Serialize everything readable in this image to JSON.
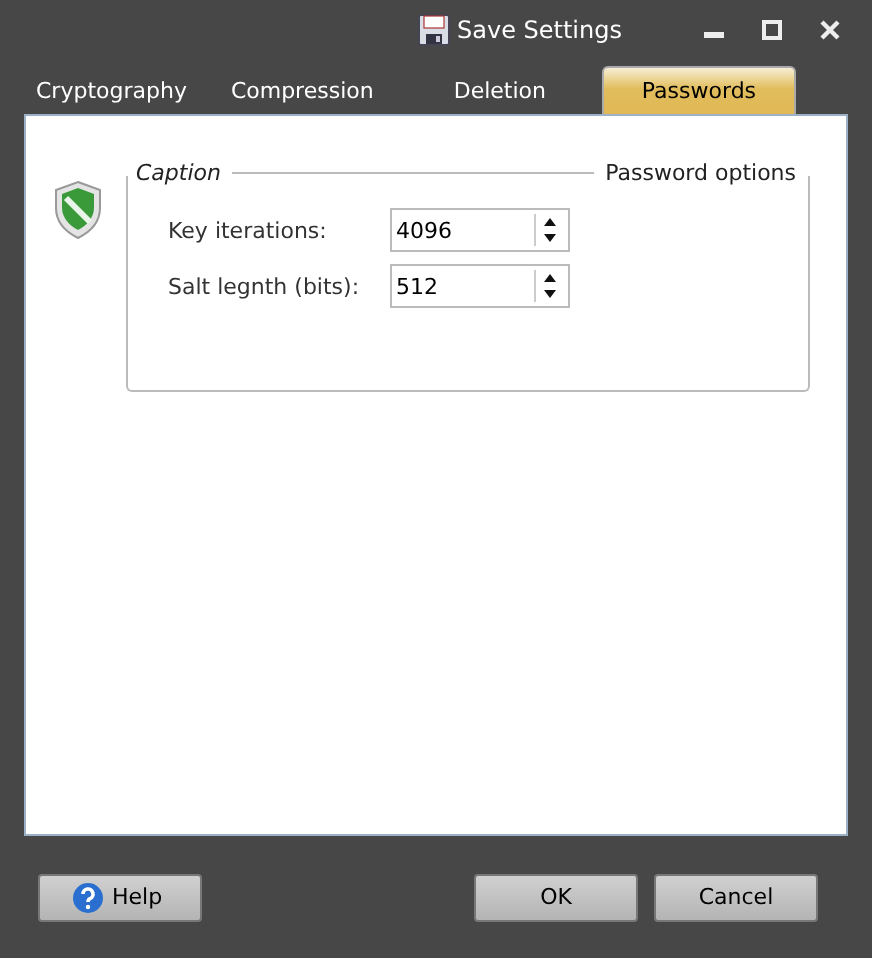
{
  "toolbar": {
    "save_label": "Save Settings"
  },
  "tabs": [
    {
      "label": "Cryptography",
      "selected": false
    },
    {
      "label": "Compression",
      "selected": false
    },
    {
      "label": "Deletion",
      "selected": false
    },
    {
      "label": "Passwords",
      "selected": true
    }
  ],
  "group": {
    "caption": "Caption",
    "title": "Password options"
  },
  "fields": [
    {
      "label": "Key iterations:",
      "value": "4096"
    },
    {
      "label": "Salt legnth (bits):",
      "value": "512"
    }
  ],
  "buttons": {
    "help": "Help",
    "ok": "OK",
    "cancel": "Cancel"
  }
}
